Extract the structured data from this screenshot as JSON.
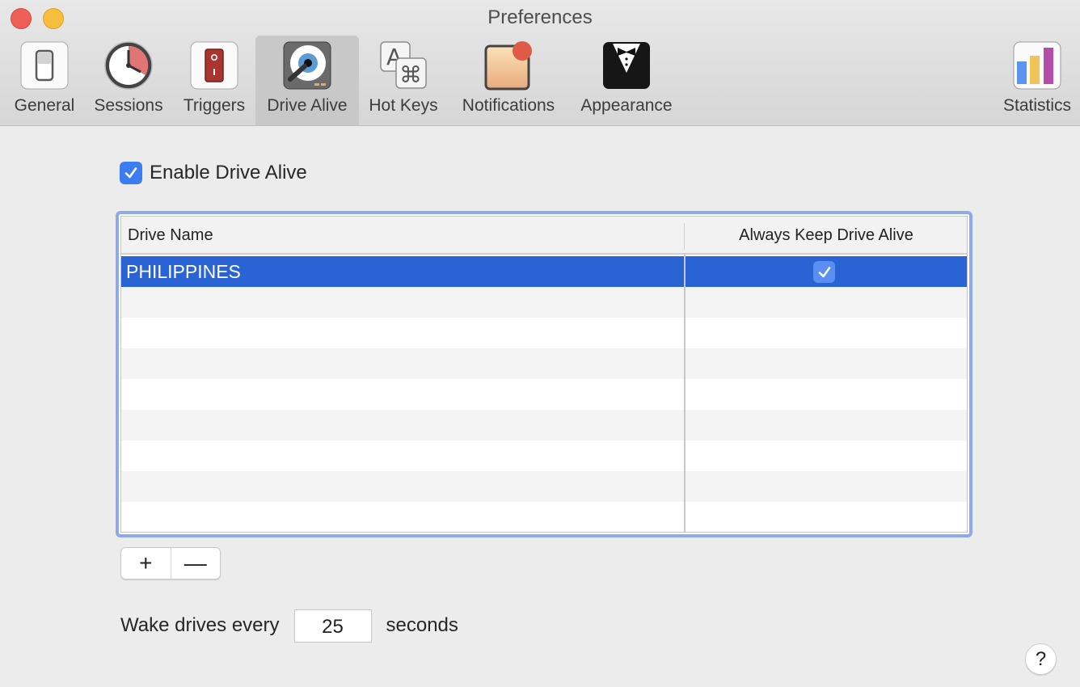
{
  "window": {
    "title": "Preferences"
  },
  "toolbar": {
    "items": [
      {
        "label": "General",
        "icon": "switch-icon",
        "selected": false
      },
      {
        "label": "Sessions",
        "icon": "clock-icon",
        "selected": false
      },
      {
        "label": "Triggers",
        "icon": "power-switch-icon",
        "selected": false
      },
      {
        "label": "Drive Alive",
        "icon": "hard-drive-icon",
        "selected": true
      },
      {
        "label": "Hot Keys",
        "icon": "command-key-icon",
        "selected": false
      },
      {
        "label": "Notifications",
        "icon": "notification-badge-icon",
        "selected": false
      },
      {
        "label": "Appearance",
        "icon": "tuxedo-icon",
        "selected": false
      },
      {
        "label": "Statistics",
        "icon": "bar-chart-icon",
        "selected": false
      }
    ]
  },
  "enable": {
    "label": "Enable Drive Alive",
    "checked": true
  },
  "table": {
    "columns": [
      "Drive Name",
      "Always Keep Drive Alive"
    ],
    "rows": [
      {
        "name": "PHILIPPINES",
        "always_keep_alive": true,
        "selected": true
      }
    ]
  },
  "buttons": {
    "add": "+",
    "remove": "—",
    "help": "?"
  },
  "wake": {
    "prefix": "Wake drives every",
    "value": "25",
    "suffix": "seconds"
  },
  "colors": {
    "accent": "#3b7df1",
    "selection": "#2a63d4",
    "focus_ring": "#8ea9ec"
  }
}
